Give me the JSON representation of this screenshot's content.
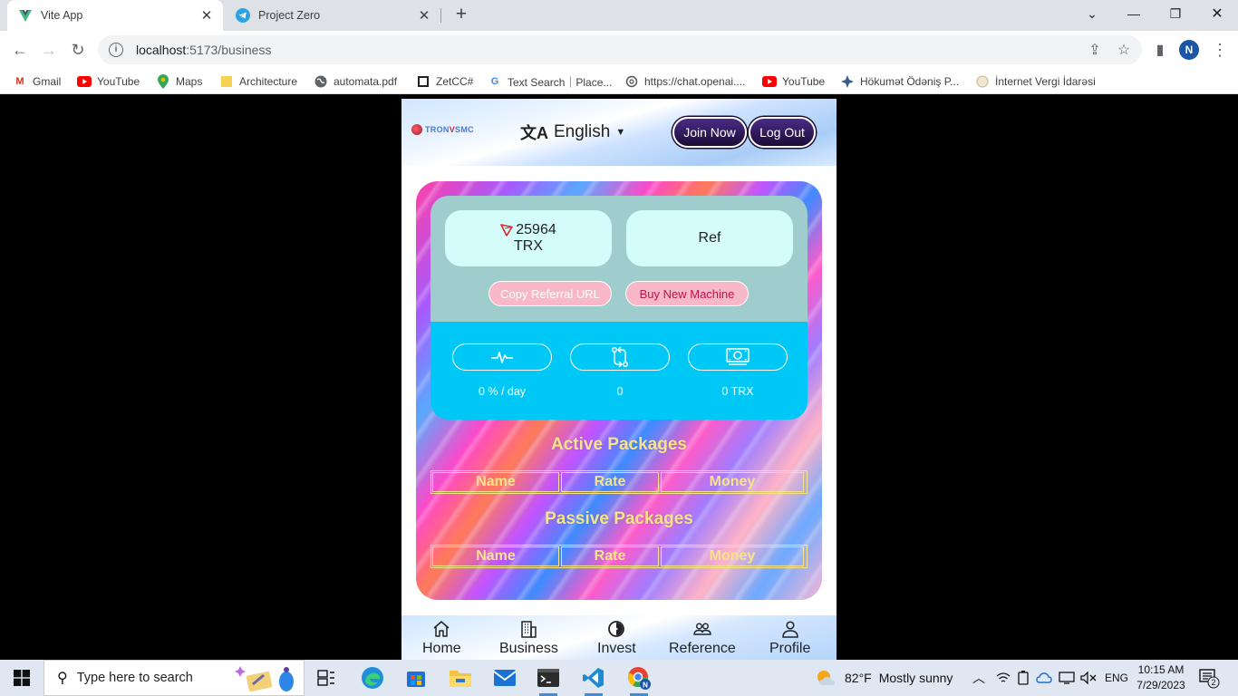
{
  "browser": {
    "tabs": [
      {
        "title": "Vite App",
        "active": true
      },
      {
        "title": "Project Zero",
        "active": false
      }
    ],
    "url_host": "localhost",
    "url_path": ":5173/business",
    "profile_initial": "N",
    "bookmarks": [
      "Gmail",
      "YouTube",
      "Maps",
      "Architecture",
      "automata.pdf",
      "ZetCC#",
      "Text Search｜Place...",
      "https://chat.openai....",
      "YouTube",
      "Hökumət Ödəniş P...",
      "İnternet Vergi İdarəsi"
    ]
  },
  "app": {
    "logo": {
      "prefix": "TRON",
      "v": "V",
      "suffix": "SMC"
    },
    "language": "English",
    "join_label": "Join Now",
    "logout_label": "Log Out",
    "balance_amount": "25964",
    "balance_unit": "TRX",
    "ref_label": "Ref",
    "copy_referral_label": "Copy Referral URL",
    "buy_machine_label": "Buy New Machine",
    "metrics": {
      "rate": "0 % / day",
      "swaps": "0",
      "earned": "0 TRX"
    },
    "active_packages": {
      "title": "Active Packages",
      "columns": [
        "Name",
        "Rate",
        "Money"
      ]
    },
    "passive_packages": {
      "title": "Passive Packages",
      "columns": [
        "Name",
        "Rate",
        "Money"
      ]
    },
    "bottom_nav": [
      "Home",
      "Business",
      "Invest",
      "Reference",
      "Profile"
    ]
  },
  "taskbar": {
    "search_placeholder": "Type here to search",
    "weather_temp": "82°F",
    "weather_desc": "Mostly sunny",
    "language": "ENG",
    "time": "10:15 AM",
    "date": "7/29/2023",
    "notification_count": "2"
  },
  "colors": {
    "stats_top_bg": "#9fcccc",
    "stats_bottom_bg": "#00c8f6",
    "section_title": "#f7e48a",
    "header_button_bg": "#2a164e"
  }
}
